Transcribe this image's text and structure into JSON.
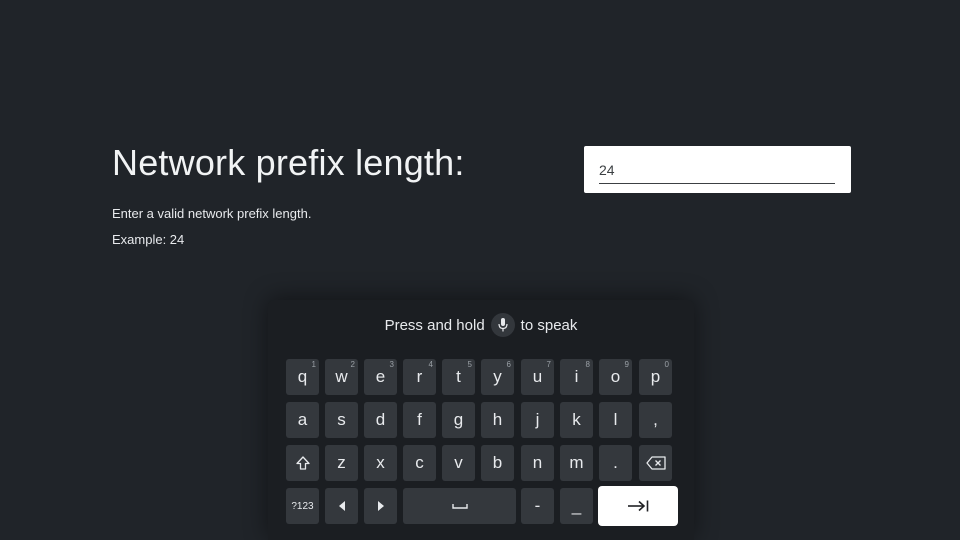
{
  "page": {
    "title": "Network prefix length:",
    "description": "Enter a valid network prefix length.",
    "example": "Example: 24"
  },
  "input": {
    "value": "24"
  },
  "keyboard": {
    "voice_hint_before": "Press and hold",
    "voice_hint_after": "to speak",
    "mic_icon": "microphone-icon",
    "row1": [
      {
        "key": "q",
        "alt": "1"
      },
      {
        "key": "w",
        "alt": "2"
      },
      {
        "key": "e",
        "alt": "3"
      },
      {
        "key": "r",
        "alt": "4"
      },
      {
        "key": "t",
        "alt": "5"
      },
      {
        "key": "y",
        "alt": "6"
      },
      {
        "key": "u",
        "alt": "7"
      },
      {
        "key": "i",
        "alt": "8"
      },
      {
        "key": "o",
        "alt": "9"
      },
      {
        "key": "p",
        "alt": "0"
      }
    ],
    "row2": [
      "a",
      "s",
      "d",
      "f",
      "g",
      "h",
      "j",
      "k",
      "l",
      ","
    ],
    "row3": {
      "shift_icon": "shift-icon",
      "letters": [
        "z",
        "x",
        "c",
        "v",
        "b",
        "n",
        "m",
        "."
      ],
      "backspace_icon": "backspace-icon"
    },
    "row4": {
      "symbols_label": "?123",
      "left_icon": "arrow-left-icon",
      "right_icon": "arrow-right-icon",
      "space_icon": "space-icon",
      "dash": "-",
      "underscore": "_",
      "enter_icon": "tab-next-icon"
    }
  }
}
